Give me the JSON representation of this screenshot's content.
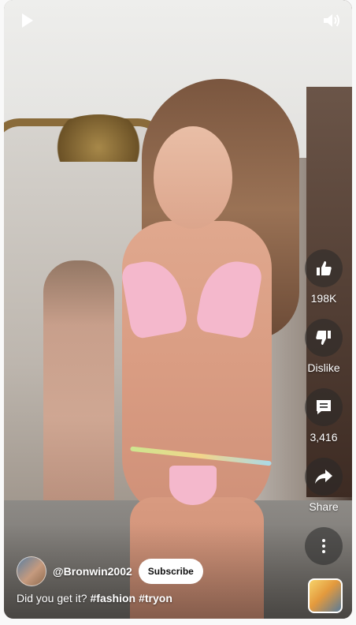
{
  "video": {
    "play_icon": "play-icon",
    "volume_icon": "volume-icon"
  },
  "actions": {
    "like": {
      "icon": "thumbs-up-icon",
      "label": "198K"
    },
    "dislike": {
      "icon": "thumbs-down-icon",
      "label": "Dislike"
    },
    "comments": {
      "icon": "comment-icon",
      "label": "3,416"
    },
    "share": {
      "icon": "share-icon",
      "label": "Share"
    },
    "more": {
      "icon": "more-vertical-icon"
    }
  },
  "channel": {
    "handle": "@Bronwin2002",
    "subscribe_label": "Subscribe"
  },
  "caption": {
    "text": "Did you get it?",
    "hashtags": [
      "#fashion",
      "#tryon"
    ]
  },
  "colors": {
    "overlay_button_bg": "#282828",
    "subscribe_bg": "#ffffff",
    "text": "#ffffff"
  }
}
